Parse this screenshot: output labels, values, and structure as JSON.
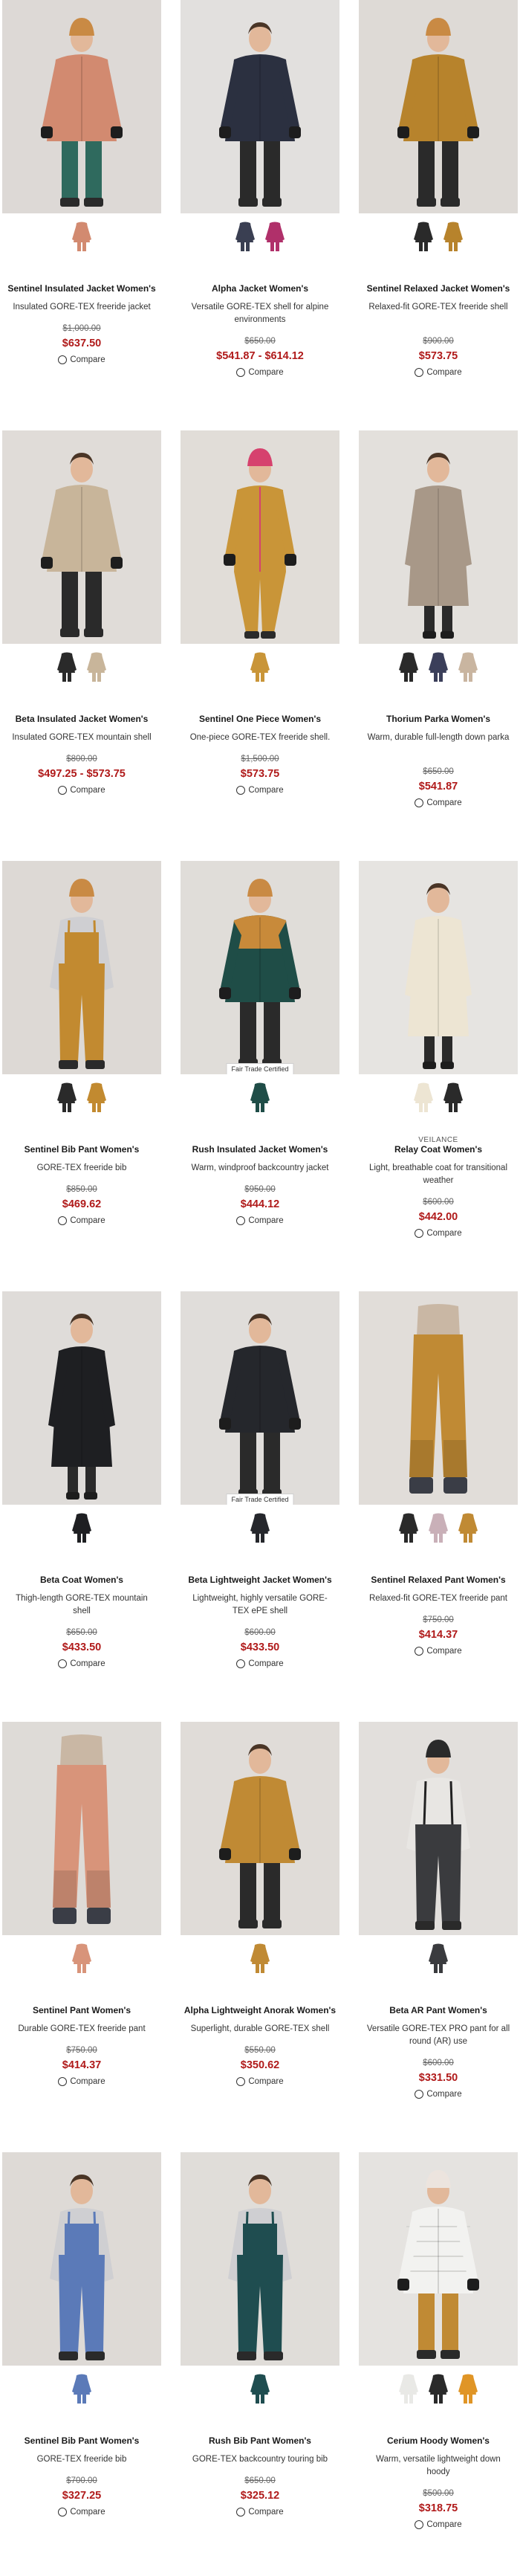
{
  "products": [
    {
      "name": "Sentinel Insulated Jacket Women's",
      "desc": "Insulated GORE-TEX freeride jacket",
      "was": "$1,000.00",
      "price": "$637.50",
      "compare": "Compare",
      "badge": "",
      "brand": "",
      "bg": "#ddd9d6",
      "garment": "#d28a70",
      "hat": "#c98a44",
      "pants": "#2f6a5e",
      "kind": "jacket",
      "swatches": [
        "#d28a70"
      ]
    },
    {
      "name": "Alpha Jacket Women's",
      "desc": "Versatile GORE-TEX shell for alpine environments",
      "was": "$650.00",
      "price": "$541.87 - $614.12",
      "compare": "Compare",
      "badge": "",
      "brand": "",
      "bg": "#e2e0de",
      "garment": "#2b3040",
      "hat": "",
      "pants": "#2a2a2a",
      "kind": "jacket",
      "swatches": [
        "#3a3f52",
        "#b0306a"
      ]
    },
    {
      "name": "Sentinel Relaxed Jacket Women's",
      "desc": "Relaxed-fit GORE-TEX freeride shell",
      "was": "$900.00",
      "price": "$573.75",
      "compare": "Compare",
      "badge": "",
      "brand": "",
      "bg": "#dedad6",
      "garment": "#b7832c",
      "hat": "#c98a44",
      "pants": "#2a2a2a",
      "kind": "jacket",
      "swatches": [
        "#2a2a2a",
        "#b7832c"
      ]
    },
    {
      "name": "Beta Insulated Jacket Women's",
      "desc": "Insulated GORE-TEX mountain shell",
      "was": "$800.00",
      "price": "$497.25 - $573.75",
      "compare": "Compare",
      "badge": "",
      "brand": "",
      "bg": "#e0dcd8",
      "garment": "#c8b59a",
      "hat": "",
      "pants": "#2a2a2a",
      "kind": "jacket",
      "swatches": [
        "#2a2a2a",
        "#c8b59a"
      ]
    },
    {
      "name": "Sentinel One Piece Women's",
      "desc": "One-piece GORE-TEX freeride shell.",
      "was": "$1,500.00",
      "price": "$573.75",
      "compare": "Compare",
      "badge": "",
      "brand": "",
      "bg": "#e1ddd8",
      "garment": "#c99538",
      "hat": "#d6426e",
      "pants": "#c99538",
      "kind": "onepiece",
      "swatches": [
        "#c99538"
      ]
    },
    {
      "name": "Thorium Parka Women's",
      "desc": "Warm, durable full-length down parka",
      "was": "$650.00",
      "price": "$541.87",
      "compare": "Compare",
      "badge": "",
      "brand": "",
      "bg": "#e3e0dc",
      "garment": "#a89888",
      "hat": "",
      "pants": "#2a2a2a",
      "kind": "coat",
      "swatches": [
        "#2a2a2a",
        "#3b3f5a",
        "#c9b5a0"
      ]
    },
    {
      "name": "Sentinel Bib Pant Women's",
      "desc": "GORE-TEX freeride bib",
      "was": "$850.00",
      "price": "$469.62",
      "compare": "Compare",
      "badge": "",
      "brand": "",
      "bg": "#ddd9d5",
      "garment": "#c28a30",
      "hat": "#c98a44",
      "pants": "#c28a30",
      "kind": "bib",
      "swatches": [
        "#2a2a2a",
        "#c28a30"
      ]
    },
    {
      "name": "Rush Insulated Jacket Women's",
      "desc": "Warm, windproof backcountry jacket",
      "was": "$950.00",
      "price": "$444.12",
      "compare": "Compare",
      "badge": "Fair Trade Certified",
      "brand": "",
      "bg": "#e0ddd9",
      "garment": "#1f4d47",
      "hat": "#c98a44",
      "pants": "#2a2a2a",
      "kind": "jacket2",
      "swatches": [
        "#1f4d47"
      ]
    },
    {
      "name": "Relay Coat Women's",
      "desc": "Light, breathable coat for transitional weather",
      "was": "$600.00",
      "price": "$442.00",
      "compare": "Compare",
      "badge": "",
      "brand": "VEILANCE",
      "bg": "#e6e4e1",
      "garment": "#ede5d3",
      "hat": "",
      "pants": "#2a2a2a",
      "kind": "coat",
      "swatches": [
        "#ede5d3",
        "#2a2a2a"
      ]
    },
    {
      "name": "Beta Coat Women's",
      "desc": "Thigh-length GORE-TEX mountain shell",
      "was": "$650.00",
      "price": "$433.50",
      "compare": "Compare",
      "badge": "",
      "brand": "",
      "bg": "#dfdcd9",
      "garment": "#1e1f22",
      "hat": "",
      "pants": "#2a2a2a",
      "kind": "coat",
      "swatches": [
        "#1e1f22"
      ]
    },
    {
      "name": "Beta Lightweight Jacket Women's",
      "desc": "Lightweight, highly versatile GORE-TEX ePE shell",
      "was": "$600.00",
      "price": "$433.50",
      "compare": "Compare",
      "badge": "Fair Trade Certified",
      "brand": "",
      "bg": "#e0ddda",
      "garment": "#25272c",
      "hat": "",
      "pants": "#2a2a2a",
      "kind": "jacket",
      "swatches": [
        "#25272c"
      ]
    },
    {
      "name": "Sentinel Relaxed Pant Women's",
      "desc": "Relaxed-fit GORE-TEX freeride pant",
      "was": "$750.00",
      "price": "$414.37",
      "compare": "Compare",
      "badge": "",
      "brand": "",
      "bg": "#e1ddd9",
      "garment": "#c08a34",
      "hat": "",
      "pants": "#c08a34",
      "kind": "pant",
      "swatches": [
        "#2a2a2a",
        "#c9b0b8",
        "#c08a34"
      ]
    },
    {
      "name": "Sentinel Pant Women's",
      "desc": "Durable GORE-TEX freeride pant",
      "was": "$750.00",
      "price": "$414.37",
      "compare": "Compare",
      "badge": "",
      "brand": "",
      "bg": "#dedbd7",
      "garment": "#d8947a",
      "hat": "",
      "pants": "#d8947a",
      "kind": "pant",
      "swatches": [
        "#d8947a"
      ]
    },
    {
      "name": "Alpha Lightweight Anorak Women's",
      "desc": "Superlight, durable GORE-TEX shell",
      "was": "$550.00",
      "price": "$350.62",
      "compare": "Compare",
      "badge": "",
      "brand": "",
      "bg": "#e0dcd8",
      "garment": "#c08a34",
      "hat": "",
      "pants": "#2a2a2a",
      "kind": "jacket",
      "swatches": [
        "#c08a34"
      ]
    },
    {
      "name": "Beta AR Pant Women's",
      "desc": "Versatile GORE-TEX PRO pant for all round (AR) use",
      "was": "$600.00",
      "price": "$331.50",
      "compare": "Compare",
      "badge": "",
      "brand": "",
      "bg": "#e2dfdc",
      "garment": "#3a3b3e",
      "hat": "#2a2a2a",
      "pants": "#3a3b3e",
      "kind": "suspender",
      "swatches": [
        "#3a3b3e"
      ]
    },
    {
      "name": "Sentinel Bib Pant Women's",
      "desc": "GORE-TEX freeride bib",
      "was": "$700.00",
      "price": "$327.25",
      "compare": "Compare",
      "badge": "",
      "brand": "",
      "bg": "#dedad6",
      "garment": "#5b7ab8",
      "hat": "",
      "pants": "#5b7ab8",
      "kind": "bib",
      "swatches": [
        "#5b7ab8"
      ]
    },
    {
      "name": "Rush Bib Pant Women's",
      "desc": "GORE-TEX backcountry touring bib",
      "was": "$650.00",
      "price": "$325.12",
      "compare": "Compare",
      "badge": "",
      "brand": "",
      "bg": "#e0ddd9",
      "garment": "#1f4d50",
      "hat": "",
      "pants": "#1f4d50",
      "kind": "bib",
      "swatches": [
        "#1f4d50"
      ]
    },
    {
      "name": "Cerium Hoody Women's",
      "desc": "Warm, versatile lightweight down hoody",
      "was": "$500.00",
      "price": "$318.75",
      "compare": "Compare",
      "badge": "",
      "brand": "",
      "bg": "#e5e3e0",
      "garment": "#f2f2f0",
      "hat": "#ece4de",
      "pants": "#c08a34",
      "kind": "puffer",
      "swatches": [
        "#e9e9e6",
        "#2a2a2a",
        "#e09526"
      ]
    }
  ]
}
